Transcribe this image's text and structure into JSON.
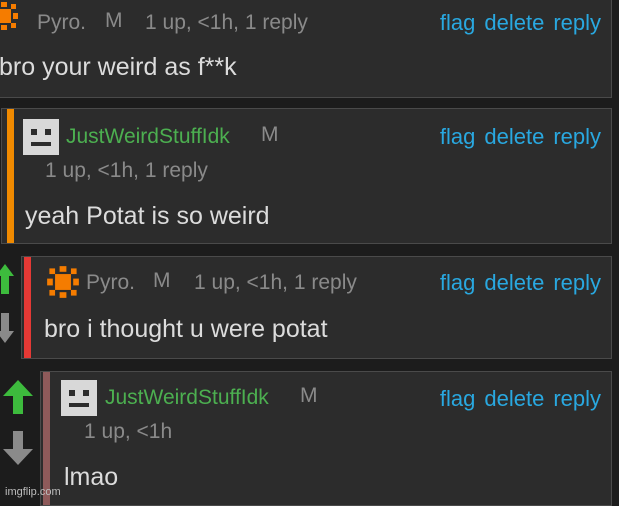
{
  "colors": {
    "accent_link": "#29a8e0",
    "username_green": "#4caf50",
    "bar_orange": "#f08a00",
    "bar_red": "#e53935",
    "bar_darkred": "#8e5a5a",
    "upvote_green": "#3dbb3d",
    "downvote_grey": "#8a8a8a"
  },
  "actions": {
    "flag": "flag",
    "delete": "delete",
    "reply": "reply"
  },
  "comments": [
    {
      "username": "Pyro.",
      "mod": "M",
      "meta": "1 up, <1h, 1 reply",
      "text": "bro your weird as f**k",
      "avatar": "orange-sun-avatar"
    },
    {
      "username": "JustWeirdStuffIdk",
      "mod": "M",
      "meta": "1 up, <1h, 1 reply",
      "text": "yeah Potat is so weird",
      "avatar": "robot-face-avatar"
    },
    {
      "username": "Pyro.",
      "mod": "M",
      "meta": "1 up, <1h, 1 reply",
      "text": "bro i thought u were potat",
      "avatar": "orange-sun-avatar"
    },
    {
      "username": "JustWeirdStuffIdk",
      "mod": "M",
      "meta": "1 up, <1h",
      "text": "lmao",
      "avatar": "robot-face-avatar"
    }
  ],
  "watermark": "imgflip.com"
}
